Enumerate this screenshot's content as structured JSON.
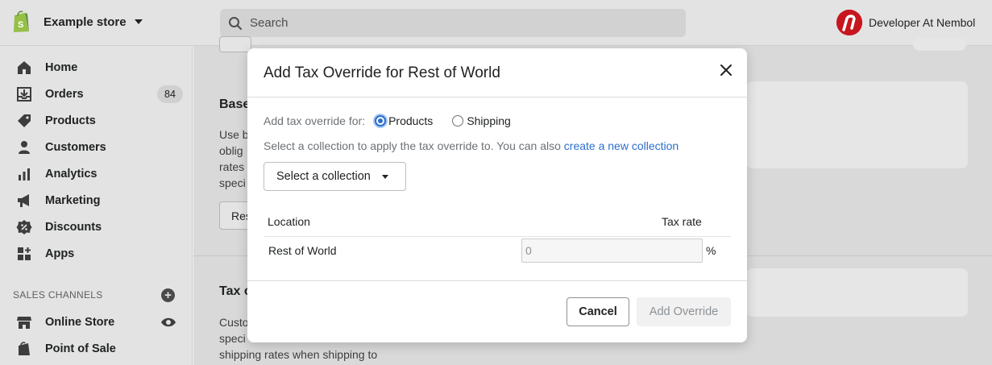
{
  "topbar": {
    "store_name": "Example store",
    "search_placeholder": "Search",
    "user_name": "Developer At Nembol"
  },
  "sidebar": {
    "items": [
      {
        "label": "Home",
        "icon": "home-icon"
      },
      {
        "label": "Orders",
        "icon": "orders-icon",
        "badge": "84"
      },
      {
        "label": "Products",
        "icon": "tag-icon"
      },
      {
        "label": "Customers",
        "icon": "person-icon"
      },
      {
        "label": "Analytics",
        "icon": "bar-chart-icon"
      },
      {
        "label": "Marketing",
        "icon": "megaphone-icon"
      },
      {
        "label": "Discounts",
        "icon": "discount-icon"
      },
      {
        "label": "Apps",
        "icon": "apps-icon"
      }
    ],
    "sales_channels_title": "SALES CHANNELS",
    "channels": [
      {
        "label": "Online Store",
        "icon": "store-icon"
      },
      {
        "label": "Point of Sale",
        "icon": "bag-icon"
      }
    ]
  },
  "background": {
    "section1_title": "Base",
    "section1_lines": [
      "Use b",
      "oblig",
      "rates",
      "speci"
    ],
    "section1_button": "Res",
    "section2_title": "Tax o",
    "section2_lines": [
      "Custo",
      "speci",
      "shipping rates when shipping to"
    ]
  },
  "modal": {
    "title": "Add Tax Override for Rest of World",
    "override_for_label": "Add tax override for:",
    "option_products": "Products",
    "option_shipping": "Shipping",
    "selected_option": "Products",
    "collection_prompt": "Select a collection to apply the tax override to. You can also",
    "collection_link": "create a new collection",
    "select_button": "Select a collection",
    "table": {
      "headers": [
        "Location",
        "Tax rate"
      ],
      "rows": [
        {
          "location": "Rest of World",
          "rate": "0",
          "unit": "%"
        }
      ]
    },
    "cancel_button": "Cancel",
    "add_button": "Add Override"
  },
  "colors": {
    "accent": "#2c6ecb",
    "avatar": "#c7161e",
    "shopify_green": "#95bf47"
  }
}
